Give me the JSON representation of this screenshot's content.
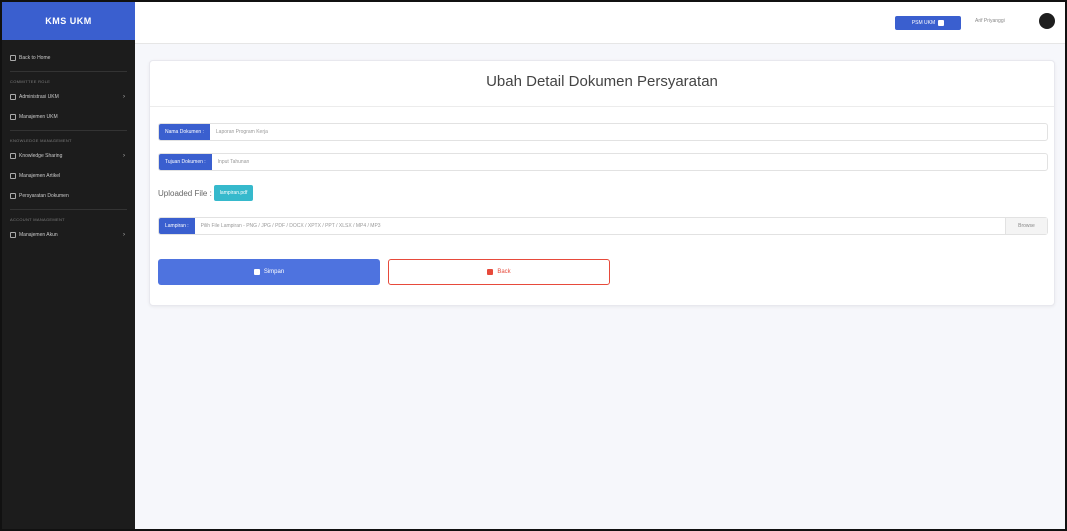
{
  "app": {
    "brand": "KMS UKM"
  },
  "sidebar": {
    "items": [
      {
        "label": "Back to Home"
      },
      {
        "heading": "COMMITTEE ROLE"
      },
      {
        "label": "Administrasi UKM",
        "has_chevron": true
      },
      {
        "label": "Manajemen UKM"
      },
      {
        "heading": "KNOWLEDGE MANAGEMENT"
      },
      {
        "label": "Knowledge Sharing",
        "has_chevron": true
      },
      {
        "label": "Manajemen Artikel"
      },
      {
        "label": "Persyaratan Dokumen"
      },
      {
        "heading": "ACCOUNT MANAGEMENT"
      },
      {
        "label": "Manajemen Akun",
        "has_chevron": true
      }
    ]
  },
  "topbar": {
    "user_button": "PSM UKM",
    "user_name": "Arif Priyanggi"
  },
  "form": {
    "title": "Ubah Detail Dokumen Persyaratan",
    "nama_label": "Nama Dokumen :",
    "nama_value": "Laporan Program Kerja",
    "tujuan_label": "Tujuan Dokumen :",
    "tujuan_value": "Input Tahunan",
    "uploaded_label": "Uploaded File :",
    "uploaded_file": "lampiran.pdf",
    "lampiran_label": "Lampiran :",
    "lampiran_placeholder": "Pilih File Lampiran - PNG / JPG / PDF / DOCX / XPTX / PPT / XLSX / MP4 / MP3",
    "browse_label": "Browse",
    "save_label": "Simpan",
    "back_label": "Back"
  }
}
